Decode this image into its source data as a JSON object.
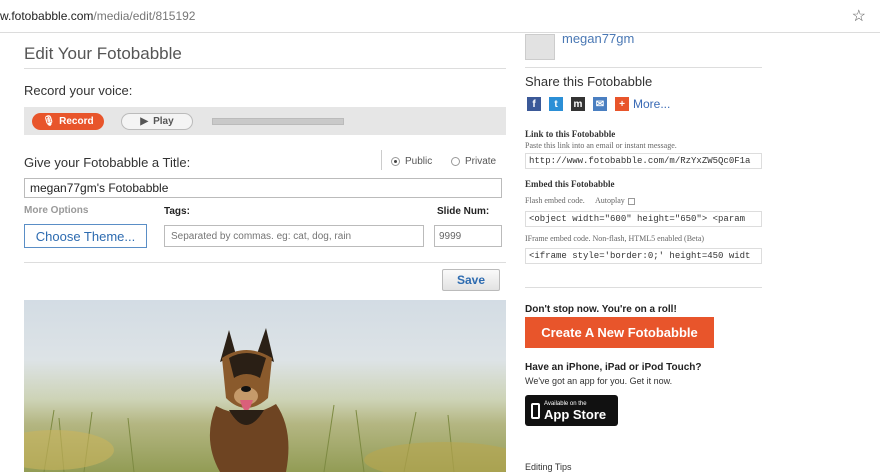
{
  "browser": {
    "url_host": "w.fotobabble.com",
    "url_path": "/media/edit/815192",
    "bookmark_icon": "star-icon"
  },
  "editor": {
    "heading": "Edit Your Fotobabble",
    "record_label": "Record your voice:",
    "record_button": "Record",
    "play_button": "Play",
    "title_label": "Give your Fotobabble a Title:",
    "visibility_options": [
      "Public",
      "Private"
    ],
    "visibility_selected": "Public",
    "title_value": "megan77gm's Fotobabble",
    "more_options": "More Options",
    "tags_label": "Tags:",
    "slide_label": "Slide Num:",
    "choose_theme_button": "Choose Theme...",
    "tags_placeholder": "Separated by commas. eg: cat, dog, rain",
    "slide_value": "9999",
    "save_button": "Save"
  },
  "sidebar": {
    "username": "megan77gm",
    "share_title": "Share this Fotobabble",
    "share_icons": [
      "facebook-icon",
      "twitter-icon",
      "myspace-icon",
      "email-icon",
      "addthis-icon"
    ],
    "more_label": "More...",
    "link_title": "Link to this Fotobabble",
    "link_hint": "Paste this link into an email or instant message.",
    "link_value": "http://www.fotobabble.com/m/RzYxZW5Qc0F1a",
    "embed_title": "Embed this Fotobabble",
    "flash_label": "Flash embed code.",
    "autoplay_label": "Autoplay",
    "flash_code": "<object width=\"600\" height=\"650\"> <param",
    "iframe_label": "IFrame embed code. Non-flash, HTML5 enabled (Beta)",
    "iframe_code": "<iframe style='border:0;' height=450 widt",
    "cta_title": "Don't stop now. You're on a roll!",
    "create_button": "Create A New Fotobabble",
    "iphone_title": "Have an iPhone, iPad or iPod Touch?",
    "iphone_sub": "We've got an app for you. Get it now.",
    "appstore_small": "Available on the",
    "appstore_big": "App Store",
    "editing_tips": "Editing Tips"
  },
  "colors": {
    "accent_orange": "#e8552b",
    "link_blue": "#3a6ab5",
    "facebook": "#3b5998",
    "twitter": "#2b8fd6",
    "myspace": "#333333",
    "email": "#4a7fc1",
    "addthis": "#e8552b"
  }
}
